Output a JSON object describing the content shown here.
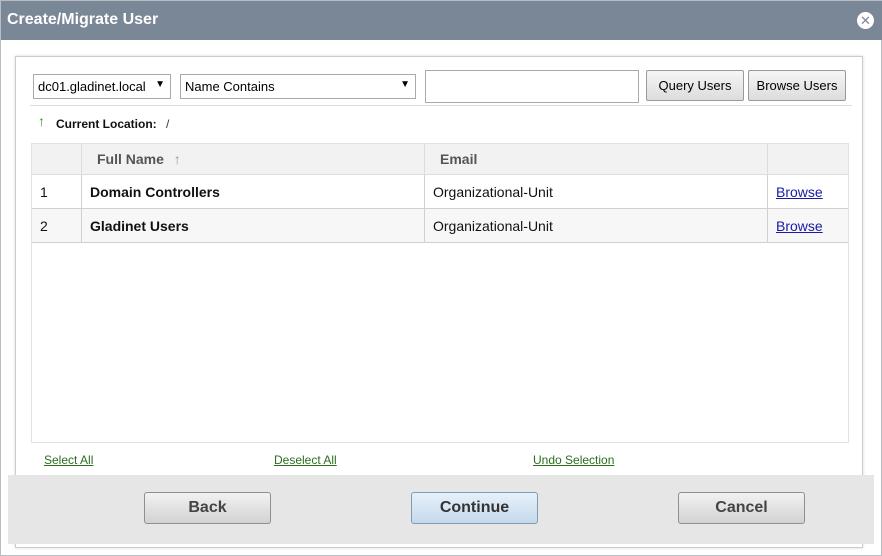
{
  "window": {
    "title": "Create/Migrate User",
    "close_glyph": "✕"
  },
  "toolbar": {
    "domain_select": "dc01.gladinet.local",
    "filter_select": "Name Contains",
    "search_value": "",
    "query_label": "Query Users",
    "browse_label": "Browse Users",
    "arrow": "▼"
  },
  "location": {
    "icon": "↑",
    "label": "Current Location:",
    "value": "/"
  },
  "table": {
    "headers": {
      "num": "",
      "name": "Full Name",
      "sort_icon": "↑",
      "email": "Email",
      "action": ""
    },
    "rows": [
      {
        "num": "1",
        "name": "Domain Controllers",
        "email": "Organizational-Unit",
        "action": "Browse"
      },
      {
        "num": "2",
        "name": "Gladinet Users",
        "email": "Organizational-Unit",
        "action": "Browse"
      }
    ]
  },
  "selection": {
    "select_all": "Select All",
    "deselect_all": "Deselect All",
    "undo": "Undo Selection"
  },
  "footer": {
    "back": "Back",
    "continue": "Continue",
    "cancel": "Cancel"
  },
  "colors": {
    "titlebar": "#7a8797",
    "link": "#1a1aa6",
    "green_link": "#2a6e1e"
  }
}
